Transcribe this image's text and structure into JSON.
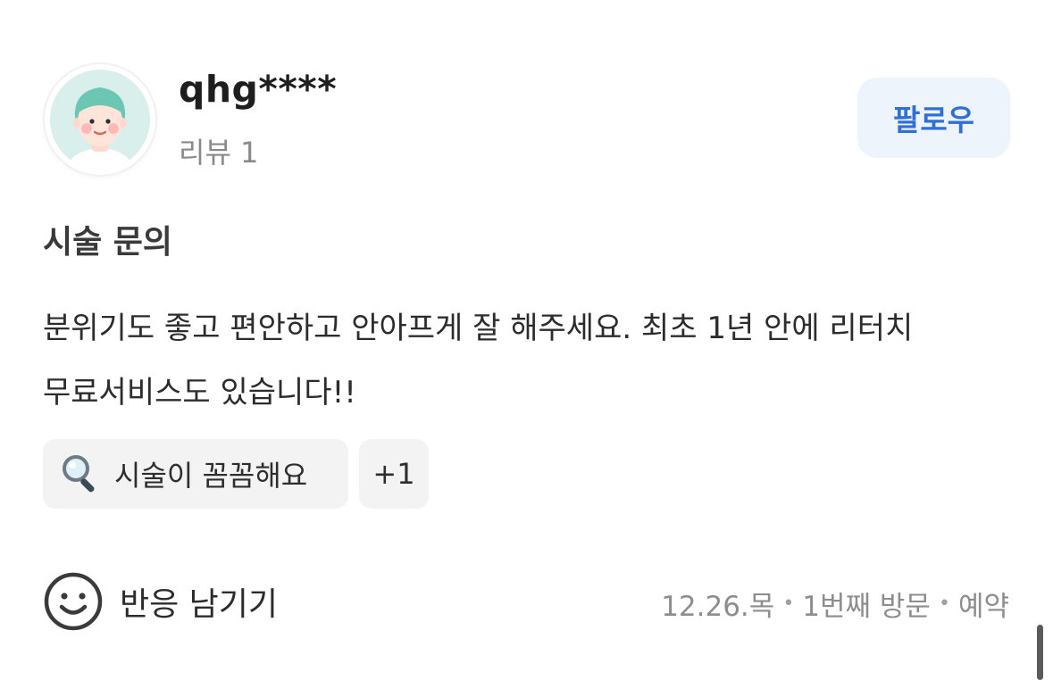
{
  "reviewer": {
    "username": "qhg****",
    "review_count_label": "리뷰 1",
    "follow_label": "팔로우"
  },
  "review": {
    "title": "시술 문의",
    "body": "분위기도 좋고 편안하고 안아프게 잘 해주세요. 최초 1년 안에 리터치 무료서비스도 있습니다!!"
  },
  "keywords": {
    "first": {
      "icon": "magnifier-icon",
      "label": "시술이 꼼꼼해요"
    },
    "more_label": "+1"
  },
  "reaction": {
    "icon": "smile-icon",
    "label": "반응 남기기"
  },
  "meta": {
    "date": "12.26.목",
    "visit": "1번째 방문",
    "type": "예약"
  },
  "colors": {
    "accent": "#2f6fd6",
    "follow_bg": "#eef4fc",
    "chip_bg": "#f3f3f4",
    "muted_text": "#8a8a8a"
  }
}
